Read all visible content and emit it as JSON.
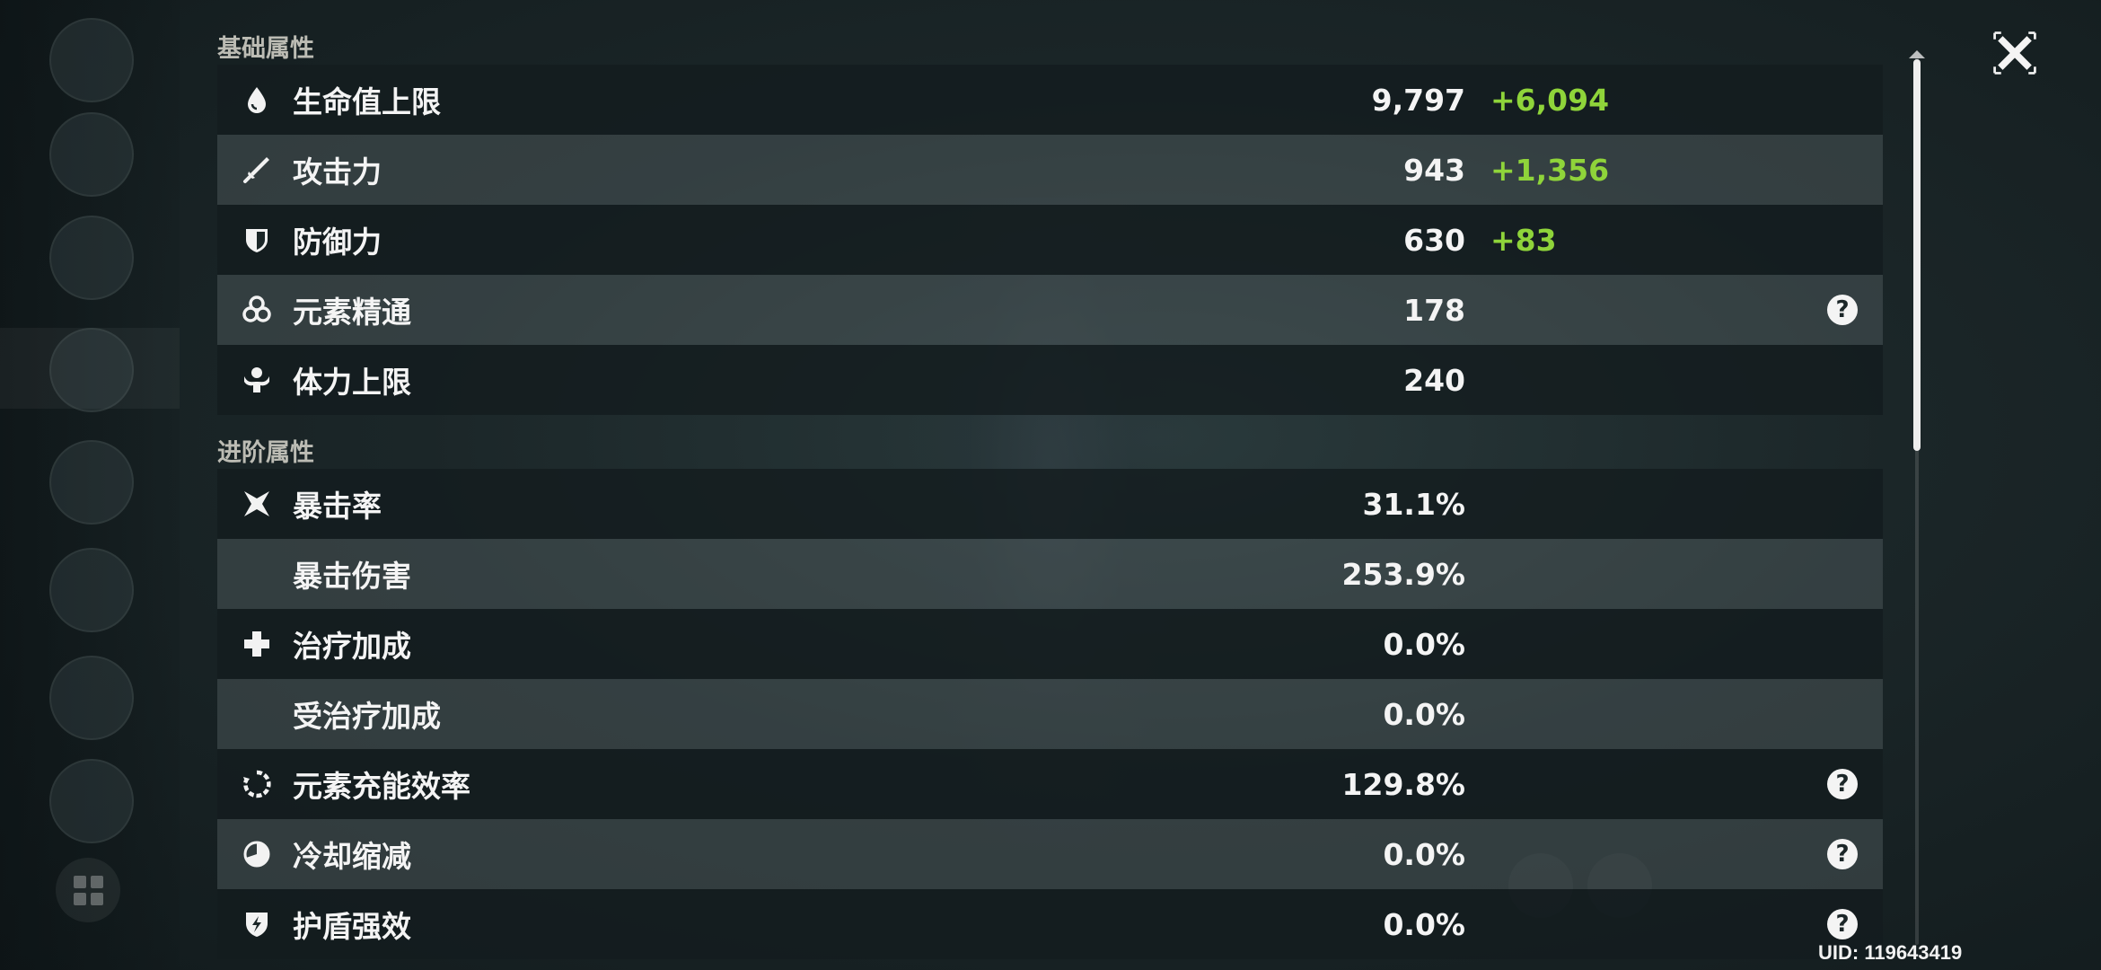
{
  "sections": {
    "basic": "基础属性",
    "advanced": "进阶属性"
  },
  "basic_stats": [
    {
      "name": "生命值上限",
      "value": "9,797",
      "bonus": "+6,094",
      "icon": "hp-drop-icon"
    },
    {
      "name": "攻击力",
      "value": "943",
      "bonus": "+1,356",
      "icon": "sword-icon"
    },
    {
      "name": "防御力",
      "value": "630",
      "bonus": "+83",
      "icon": "shield-icon"
    },
    {
      "name": "元素精通",
      "value": "178",
      "bonus": "",
      "icon": "elemental-mastery-icon"
    },
    {
      "name": "体力上限",
      "value": "240",
      "bonus": "",
      "icon": "stamina-icon"
    }
  ],
  "advanced_stats": [
    {
      "name": "暴击率",
      "value": "31.1%",
      "icon": "crit-star-icon"
    },
    {
      "name": "暴击伤害",
      "value": "253.9%",
      "icon": ""
    },
    {
      "name": "治疗加成",
      "value": "0.0%",
      "icon": "healing-cross-icon"
    },
    {
      "name": "受治疗加成",
      "value": "0.0%",
      "icon": ""
    },
    {
      "name": "元素充能效率",
      "value": "129.8%",
      "icon": "energy-recharge-icon"
    },
    {
      "name": "冷却缩减",
      "value": "0.0%",
      "icon": "cooldown-icon"
    },
    {
      "name": "护盾强效",
      "value": "0.0%",
      "icon": "shield-strength-icon"
    }
  ],
  "uid": "UID: 119643419",
  "colors": {
    "bonus_green": "#8fd43a",
    "row_dark": "#141c1e",
    "row_light": "#555f62"
  }
}
